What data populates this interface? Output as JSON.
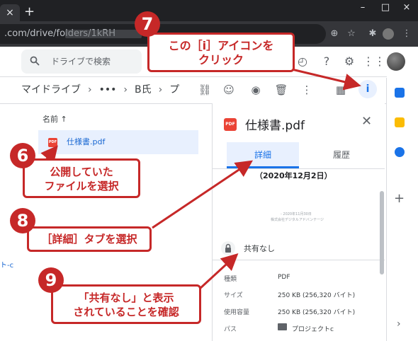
{
  "browser": {
    "tab_close": "×",
    "new_tab": "+",
    "window_minimize": "–",
    "window_maximize": "□",
    "window_close": "×",
    "url": ".com/drive/folders/1kRH"
  },
  "drive": {
    "search_placeholder": "ドライブで検索",
    "breadcrumb": {
      "root": "マイドライブ",
      "ellipsis": "•••",
      "folder": "B氏",
      "current": "プ"
    },
    "list_header": "名前 ↑",
    "file_name": "仕様書.pdf",
    "side_partial": "ト-c"
  },
  "details": {
    "file_title": "仕様書.pdf",
    "pdf_badge": "PDF",
    "tab_detail": "詳細",
    "tab_history": "履歴",
    "preview_date": "（2020年12月2日）",
    "thumb_line1": "- 2020年11月30日",
    "thumb_line2": "株式会社デジタルアドバンテージ",
    "share_status": "共有なし",
    "rows": [
      {
        "label": "種類",
        "value": "PDF"
      },
      {
        "label": "サイズ",
        "value": "250 KB (256,320 バイト)"
      },
      {
        "label": "使用容量",
        "value": "250 KB (256,320 バイト)"
      },
      {
        "label": "パス",
        "value": "プロジェクトc"
      }
    ]
  },
  "annotations": {
    "step6": {
      "number": "6",
      "line1": "公開していた",
      "line2": "ファイルを選択"
    },
    "step7": {
      "number": "7",
      "line1": "この［i］アイコンを",
      "line2": "クリック"
    },
    "step8": {
      "number": "8",
      "text": "［詳細］タブを選択"
    },
    "step9": {
      "number": "9",
      "line1": "「共有なし」と表示",
      "line2": "されていることを確認"
    }
  },
  "colors": {
    "annotation_red": "#c62828",
    "drive_blue": "#1a73e8",
    "selection_bg": "#e8f0fe",
    "pdf_red": "#ea4335"
  },
  "icons": [
    "search-icon",
    "offline-icon",
    "help-icon",
    "settings-icon",
    "link-icon",
    "add-person-icon",
    "preview-icon",
    "trash-icon",
    "more-icon",
    "grid-view-icon",
    "info-icon",
    "lock-icon",
    "folder-icon"
  ]
}
